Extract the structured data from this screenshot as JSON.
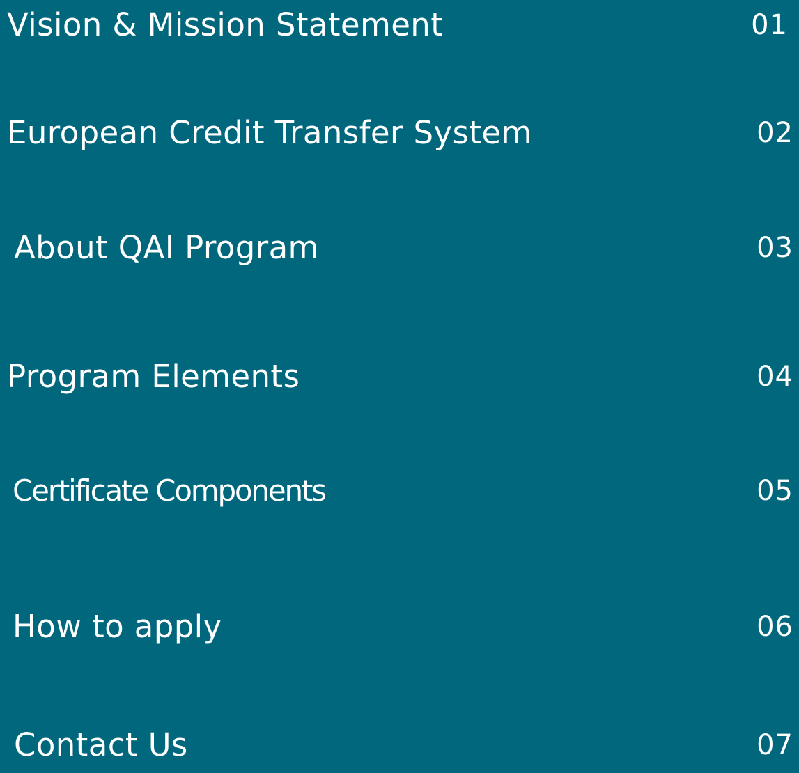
{
  "background_color": "#01677d",
  "text_color": "#ffffff",
  "toc": {
    "items": [
      {
        "title": "Vision & Mission Statement",
        "number": "01"
      },
      {
        "title": "European Credit Transfer System",
        "number": "02"
      },
      {
        "title": "About QAI Program",
        "number": "03"
      },
      {
        "title": "Program Elements",
        "number": "04"
      },
      {
        "title": "Certificate Components",
        "number": "05"
      },
      {
        "title": "How to apply",
        "number": "06"
      },
      {
        "title": "Contact Us",
        "number": "07"
      }
    ]
  }
}
